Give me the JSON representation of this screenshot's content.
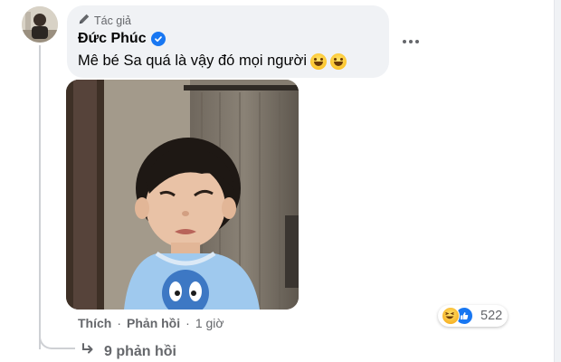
{
  "comment": {
    "author_badge": "Tác giả",
    "author_name": "Đức Phúc",
    "text": "Mê bé Sa quá là vậy đó mọi người",
    "emojis": [
      "grinning-tears-emoji",
      "grinning-tears-emoji"
    ],
    "verified": true
  },
  "actions": {
    "like_label": "Thích",
    "reply_label": "Phản hồi",
    "separator": "·",
    "time": "1 giờ"
  },
  "reactions": {
    "types": [
      "haha",
      "like"
    ],
    "count": "522"
  },
  "replies": {
    "label": "9 phản hồi"
  },
  "colors": {
    "bubble_bg": "#f0f2f5",
    "secondary_text": "#65676b",
    "verified_blue": "#1877f2"
  }
}
